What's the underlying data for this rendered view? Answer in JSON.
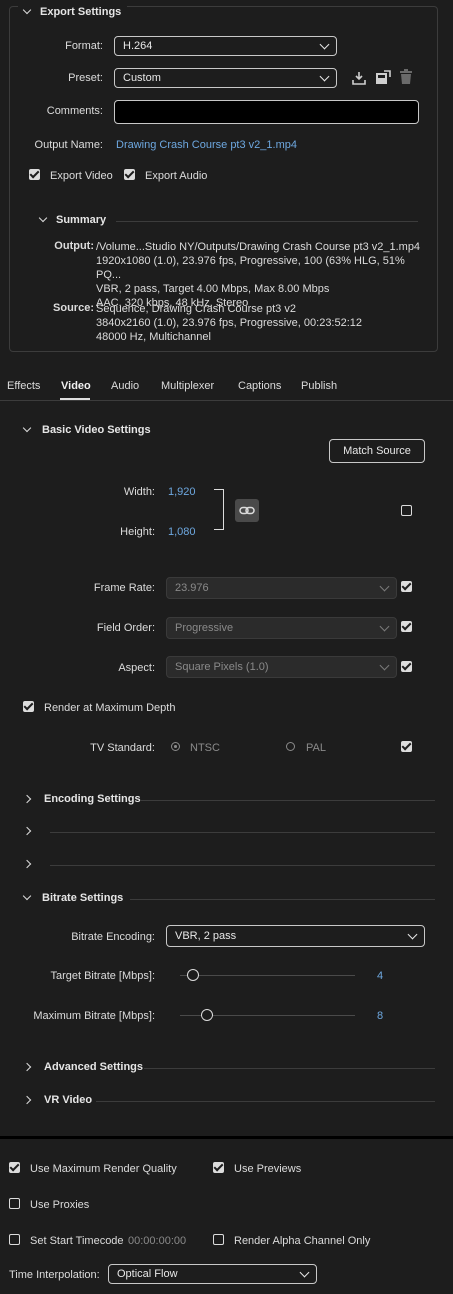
{
  "export_settings": {
    "title": "Export Settings",
    "format_label": "Format:",
    "format_value": "H.264",
    "preset_label": "Preset:",
    "preset_value": "Custom",
    "comments_label": "Comments:",
    "comments_value": "",
    "output_name_label": "Output Name:",
    "output_name_value": "Drawing Crash Course pt3 v2_1.mp4",
    "export_video_label": "Export Video",
    "export_video_checked": true,
    "export_audio_label": "Export Audio",
    "export_audio_checked": true,
    "summary": {
      "title": "Summary",
      "output_label": "Output:",
      "output_lines": [
        "/Volume...Studio NY/Outputs/Drawing Crash Course pt3 v2_1.mp4",
        "1920x1080 (1.0), 23.976 fps, Progressive, 100 (63% HLG, 51% PQ...",
        "VBR, 2 pass, Target 4.00 Mbps, Max 8.00 Mbps",
        "AAC, 320 kbps, 48 kHz, Stereo"
      ],
      "source_label": "Source:",
      "source_lines": [
        "Sequence, Drawing Crash Course pt3 v2",
        "3840x2160 (1.0), 23.976 fps, Progressive, 00:23:52:12",
        "48000 Hz, Multichannel"
      ]
    }
  },
  "tabs": [
    {
      "label": "Effects",
      "active": false
    },
    {
      "label": "Video",
      "active": true
    },
    {
      "label": "Audio",
      "active": false
    },
    {
      "label": "Multiplexer",
      "active": false
    },
    {
      "label": "Captions",
      "active": false
    },
    {
      "label": "Publish",
      "active": false
    }
  ],
  "basic_video": {
    "title": "Basic Video Settings",
    "match_source_label": "Match Source",
    "width_label": "Width:",
    "width_value": "1,920",
    "height_label": "Height:",
    "height_value": "1,080",
    "frame_rate_label": "Frame Rate:",
    "frame_rate_value": "23.976",
    "field_order_label": "Field Order:",
    "field_order_value": "Progressive",
    "aspect_label": "Aspect:",
    "aspect_value": "Square Pixels (1.0)",
    "render_max_depth_label": "Render at Maximum Depth",
    "tv_standard_label": "TV Standard:",
    "ntsc_label": "NTSC",
    "pal_label": "PAL"
  },
  "encoding_settings": {
    "title": "Encoding Settings"
  },
  "bitrate": {
    "title": "Bitrate Settings",
    "encoding_label": "Bitrate Encoding:",
    "encoding_value": "VBR, 2 pass",
    "target_label": "Target Bitrate [Mbps]:",
    "target_value": "4",
    "max_label": "Maximum Bitrate [Mbps]:",
    "max_value": "8"
  },
  "advanced_settings": {
    "title": "Advanced Settings"
  },
  "vr_video": {
    "title": "VR Video"
  },
  "footer": {
    "max_render_quality_label": "Use Maximum Render Quality",
    "use_previews_label": "Use Previews",
    "use_proxies_label": "Use Proxies",
    "set_start_timecode_label": "Set Start Timecode",
    "start_timecode_value": "00:00:00:00",
    "render_alpha_label": "Render Alpha Channel Only",
    "time_interp_label": "Time Interpolation:",
    "time_interp_value": "Optical Flow"
  },
  "colors": {
    "background": "#1d1d1d",
    "link_blue": "#6ea8e0",
    "text": "#dcdcdc"
  }
}
